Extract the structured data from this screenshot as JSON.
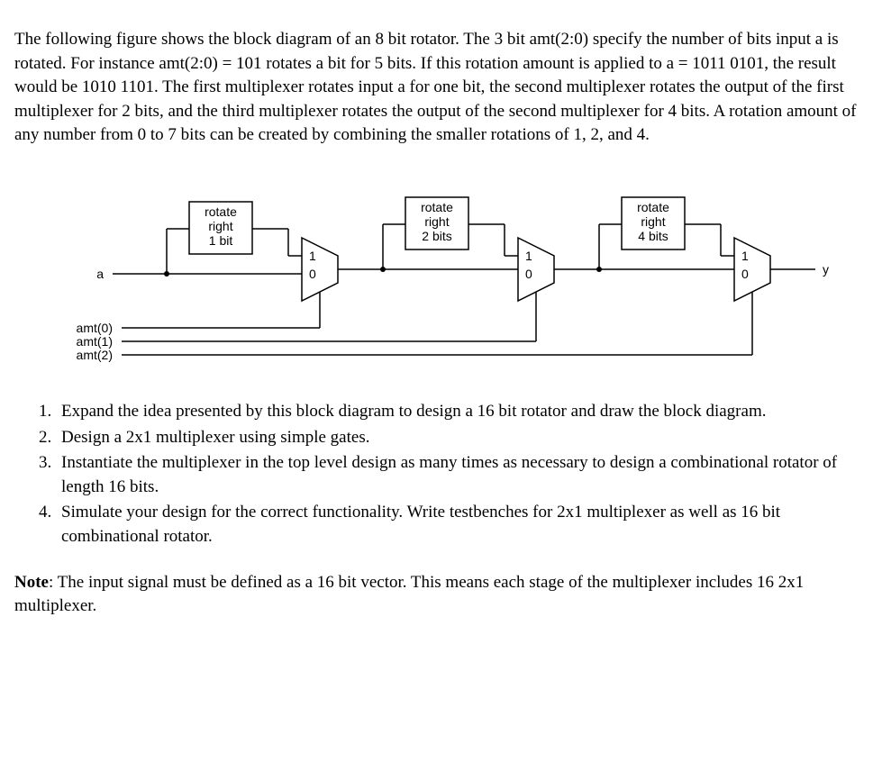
{
  "intro": "The following figure shows the block diagram of an 8 bit rotator. The 3 bit amt(2:0) specify the number of bits input a is rotated. For instance amt(2:0) = 101 rotates a bit for 5 bits. If this rotation amount is applied to a = 1011 0101, the result would be 1010 1101. The first multiplexer rotates input a for one bit, the second multiplexer rotates the output of the first multiplexer for 2 bits, and the third multiplexer rotates the output of the second multiplexer for 4 bits. A rotation amount of any number from 0 to 7 bits can be created by combining the smaller rotations of 1, 2, and 4.",
  "diagram": {
    "input_label": "a",
    "output_label": "y",
    "amt_labels": [
      "amt(0)",
      "amt(1)",
      "amt(2)"
    ],
    "stages": [
      {
        "line1": "rotate",
        "line2": "right",
        "line3": "1 bit"
      },
      {
        "line1": "rotate",
        "line2": "right",
        "line3": "2 bits"
      },
      {
        "line1": "rotate",
        "line2": "right",
        "line3": "4 bits"
      }
    ],
    "mux_in1": "1",
    "mux_in0": "0"
  },
  "questions": [
    "Expand the idea presented by this block diagram to design a 16 bit rotator and draw the block diagram.",
    "Design a 2x1 multiplexer using simple gates.",
    "Instantiate the multiplexer in the top level design as many times as necessary to design a combinational rotator of length 16 bits.",
    "Simulate your design for the correct functionality. Write testbenches for 2x1 multiplexer as well as 16 bit combinational rotator."
  ],
  "note_bold": "Note",
  "note_text": ": The input signal must be defined as a 16 bit vector. This means each stage of the multiplexer includes 16 2x1 multiplexer."
}
